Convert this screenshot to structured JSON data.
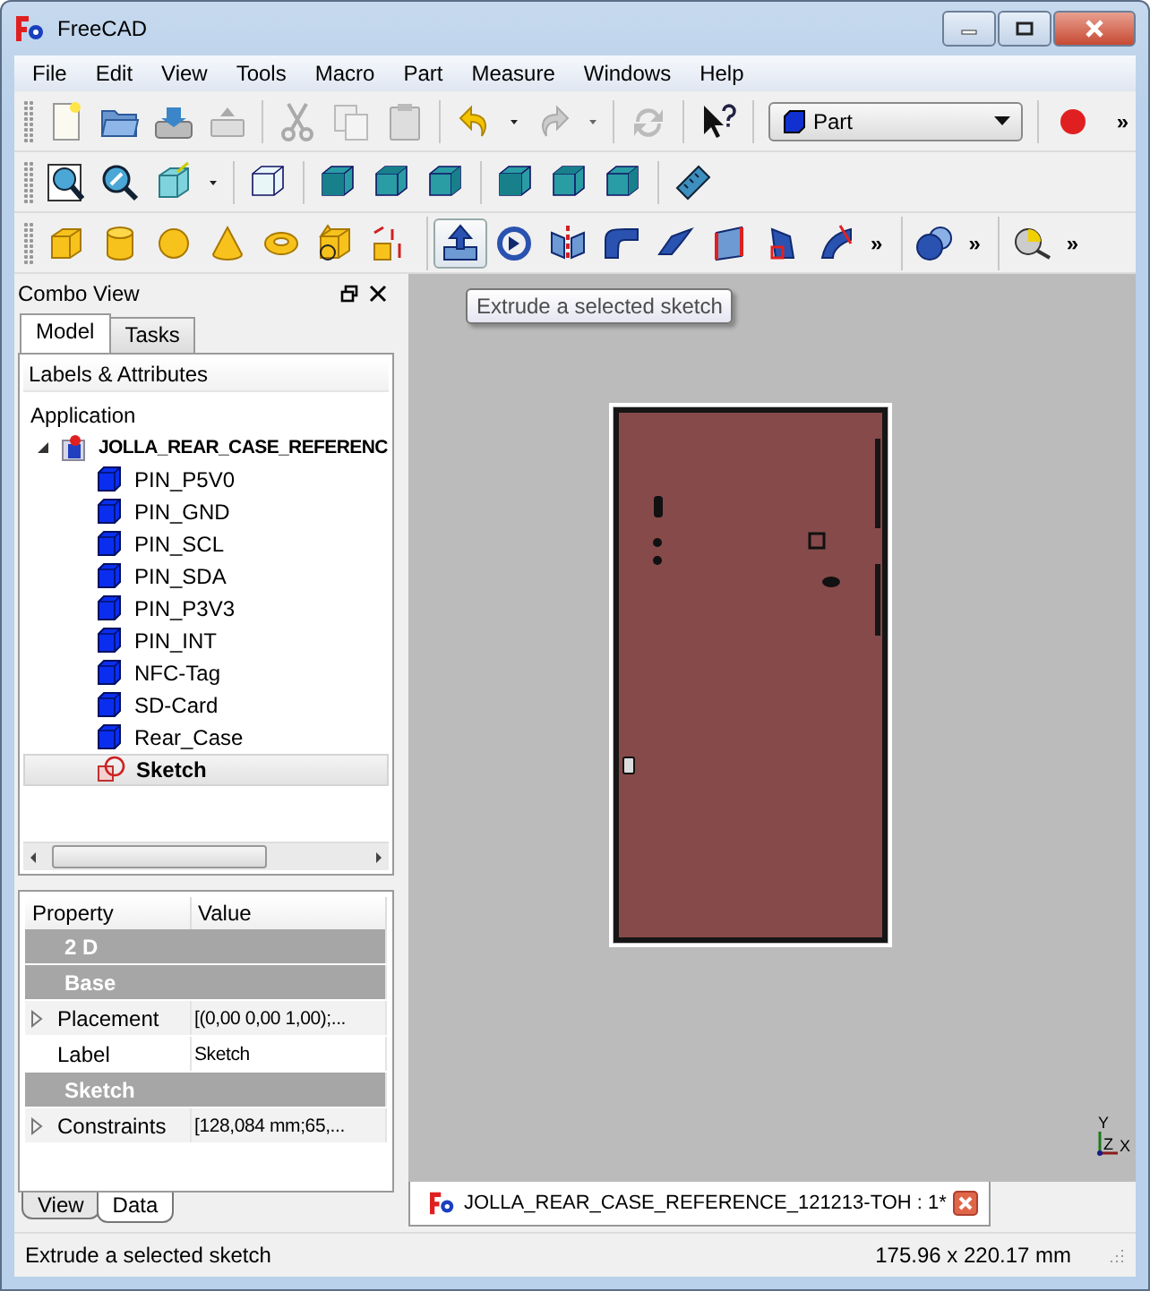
{
  "window": {
    "title": "FreeCAD"
  },
  "menu": [
    "File",
    "Edit",
    "View",
    "Tools",
    "Macro",
    "Part",
    "Measure",
    "Windows",
    "Help"
  ],
  "workbench_selector": {
    "value": "Part"
  },
  "toolbar_1": {
    "overflow": "»"
  },
  "toolbar_3": {
    "overflow": [
      "»",
      "»",
      "»"
    ]
  },
  "tooltip": "Extrude a selected sketch",
  "combo_view": {
    "title": "Combo View",
    "tabs": [
      {
        "label": "Model",
        "selected": true
      },
      {
        "label": "Tasks",
        "selected": false
      }
    ],
    "tree_header": "Labels & Attributes",
    "tree": [
      {
        "label": "Application",
        "kind": "root",
        "selected": false,
        "children": [
          {
            "label": "JOLLA_REAR_CASE_REFERENC",
            "kind": "document",
            "selected": false,
            "expanded": true,
            "children": [
              {
                "label": "PIN_P5V0",
                "kind": "solid",
                "selected": false
              },
              {
                "label": "PIN_GND",
                "kind": "solid",
                "selected": false
              },
              {
                "label": "PIN_SCL",
                "kind": "solid",
                "selected": false
              },
              {
                "label": "PIN_SDA",
                "kind": "solid",
                "selected": false
              },
              {
                "label": "PIN_P3V3",
                "kind": "solid",
                "selected": false
              },
              {
                "label": "PIN_INT",
                "kind": "solid",
                "selected": false
              },
              {
                "label": "NFC-Tag",
                "kind": "solid",
                "selected": false
              },
              {
                "label": "SD-Card",
                "kind": "solid",
                "selected": false
              },
              {
                "label": "Rear_Case",
                "kind": "solid",
                "selected": false
              },
              {
                "label": "Sketch",
                "kind": "sketch",
                "selected": true
              }
            ]
          }
        ]
      }
    ],
    "property_table": {
      "columns": [
        "Property",
        "Value"
      ],
      "rows": [
        {
          "kind": "group",
          "label": "2 D"
        },
        {
          "kind": "group",
          "label": "Base"
        },
        {
          "kind": "property",
          "label": "Placement",
          "value": "[(0,00 0,00 1,00);...",
          "expandable": true
        },
        {
          "kind": "property",
          "label": "Label",
          "value": "Sketch",
          "expandable": false
        },
        {
          "kind": "group",
          "label": "Sketch"
        },
        {
          "kind": "property",
          "label": "Constraints",
          "value": "[128,084 mm;65,...",
          "expandable": true
        }
      ]
    },
    "bottom_tabs": [
      {
        "label": "View",
        "selected": false
      },
      {
        "label": "Data",
        "selected": true
      }
    ]
  },
  "viewport": {
    "axis_labels": [
      "Y",
      "Z",
      "X"
    ]
  },
  "document_tab": {
    "label": "JOLLA_REAR_CASE_REFERENCE_121213-TOH : 1*"
  },
  "status_bar": {
    "message": "Extrude a selected sketch",
    "dimensions": "175.96 x 220.17 mm"
  }
}
